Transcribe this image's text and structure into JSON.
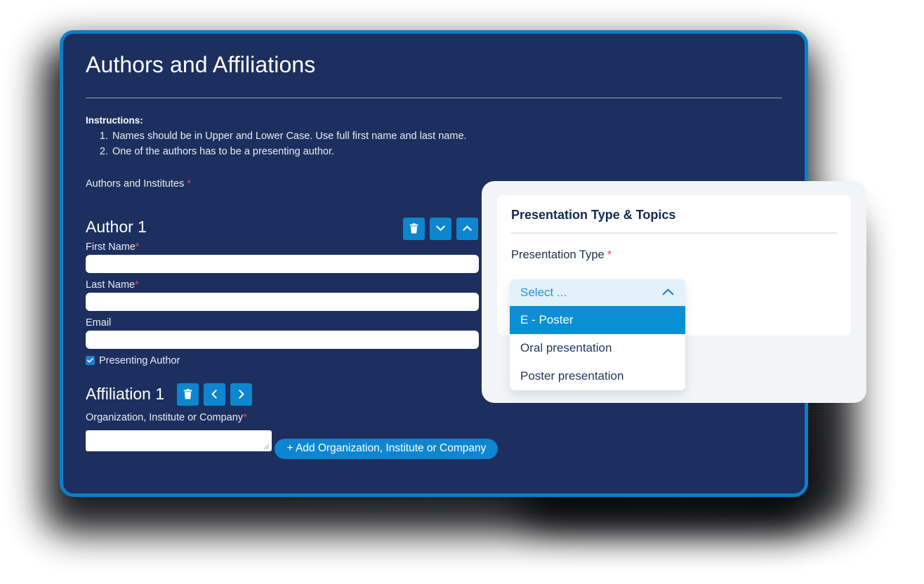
{
  "form_panel": {
    "title": "Authors and Affiliations",
    "instructions_heading": "Instructions:",
    "instructions": [
      "Names should be in Upper and Lower Case. Use full first name and last name.",
      "One of the authors has to be a presenting author."
    ],
    "section_legend": "Authors and Institutes",
    "required_mark": "*",
    "author": {
      "heading": "Author 1",
      "buttons": [
        {
          "name": "delete-author-button",
          "icon": "trash-icon"
        },
        {
          "name": "move-author-down-button",
          "icon": "chevron-down-icon"
        },
        {
          "name": "move-author-up-button",
          "icon": "chevron-up-icon"
        }
      ],
      "fields": [
        {
          "label": "First Name",
          "required": true,
          "value": "",
          "placeholder": ""
        },
        {
          "label": "Last Name",
          "required": true,
          "value": "",
          "placeholder": ""
        },
        {
          "label": "Email",
          "required": false,
          "value": "",
          "placeholder": ""
        }
      ],
      "presenting_author_label": "Presenting Author",
      "presenting_author_checked": true
    },
    "affiliation": {
      "heading": "Affiliation 1",
      "buttons": [
        {
          "name": "delete-affiliation-button",
          "icon": "trash-icon"
        },
        {
          "name": "move-affiliation-left-button",
          "icon": "chevron-left-icon"
        },
        {
          "name": "move-affiliation-right-button",
          "icon": "chevron-right-icon"
        }
      ],
      "org_label": "Organization, Institute or Company",
      "org_required": true,
      "org_value": "",
      "add_button_label": "+ Add Organization, Institute or Company"
    }
  },
  "side_card": {
    "title": "Presentation Type & Topics",
    "field_label": "Presentation Type",
    "required_mark": "*",
    "dropdown": {
      "selected_text": "Select ...",
      "expanded": true,
      "chevron": "chevron-up-icon",
      "options": [
        {
          "label": "E - Poster",
          "highlighted": true
        },
        {
          "label": "Oral presentation",
          "highlighted": false
        },
        {
          "label": "Poster presentation",
          "highlighted": false
        }
      ]
    }
  },
  "colors": {
    "navy_panel": "#1c2f5e",
    "panel_border_blue": "#0d7fc9",
    "accent_blue": "#0d86cf",
    "dropdown_highlight": "#0a8fd4",
    "dropdown_trigger_bg": "#e3f1fb",
    "dropdown_trigger_text": "#2196d8",
    "required_red": "#e8445a",
    "card_gray": "#f2f4f7"
  }
}
